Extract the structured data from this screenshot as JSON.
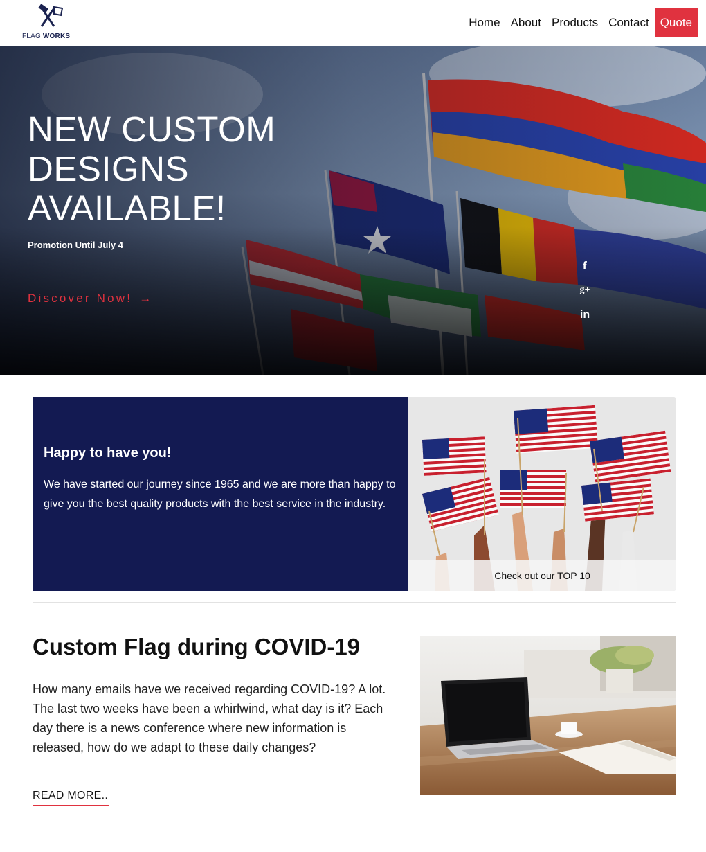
{
  "header": {
    "logo": {
      "text_light": "FLAG ",
      "text_bold": "WORKS"
    },
    "nav": [
      {
        "label": "Home"
      },
      {
        "label": "About"
      },
      {
        "label": "Products"
      },
      {
        "label": "Contact"
      },
      {
        "label": "Quote"
      }
    ]
  },
  "hero": {
    "title": "NEW CUSTOM DESIGNS AVAILABLE!",
    "subtitle": "Promotion Until July 4",
    "cta_label": "Discover Now!",
    "cta_arrow": "→",
    "social": {
      "facebook": "f",
      "google_plus": "g+",
      "linkedin": "in"
    }
  },
  "welcome": {
    "title": "Happy to have you!",
    "text": "We have started our journey since 1965 and we are more than happy to give you the best quality products with the best service in the industry.",
    "image_caption": "Check out our TOP 10"
  },
  "article": {
    "title": "Custom Flag during COVID-19",
    "text": "How many emails have we received regarding COVID-19? A lot. The last two weeks have been a whirlwind, what day is it? Each day there is a news conference where new information is released, how do we adapt to these daily changes?",
    "read_more": "READ MORE.."
  },
  "colors": {
    "accent": "#e0323f",
    "navy": "#131a52"
  }
}
